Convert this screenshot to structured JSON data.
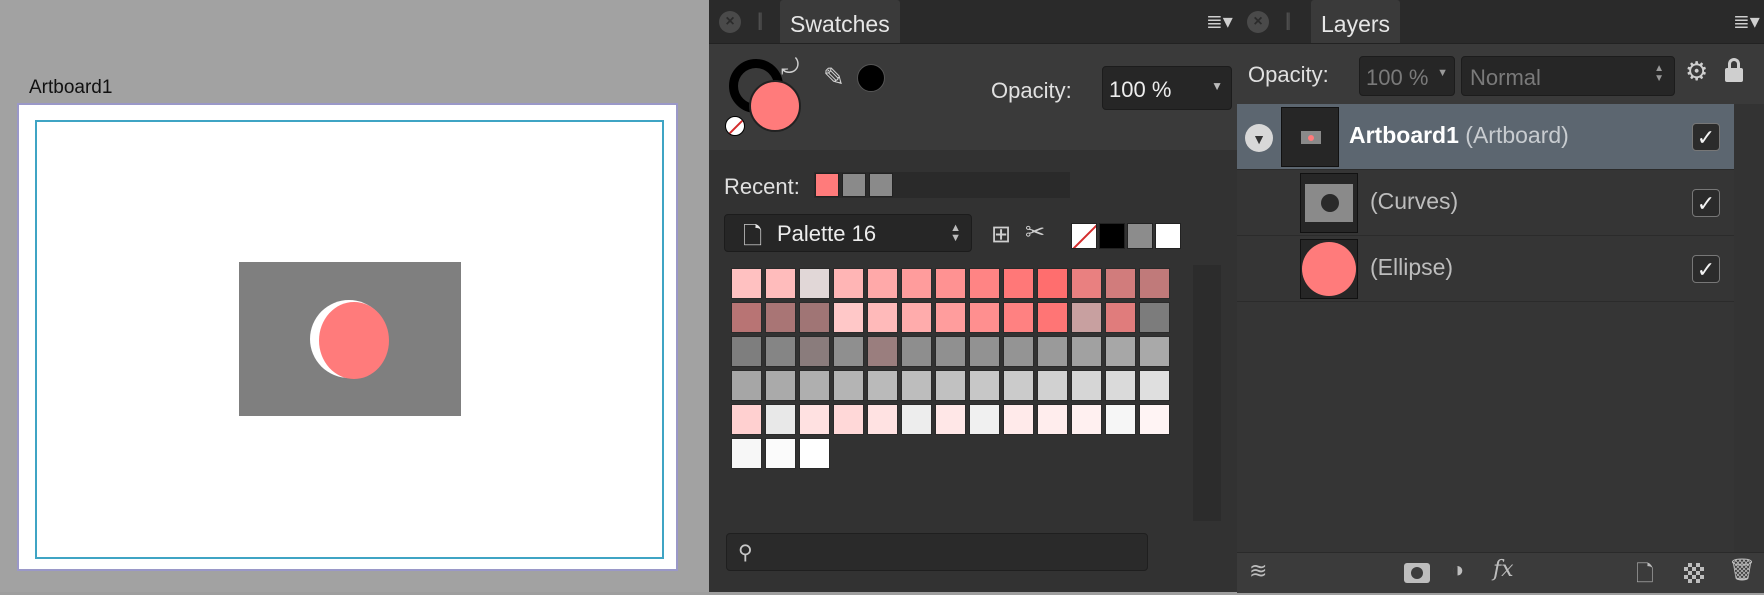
{
  "canvas": {
    "artboard_label": "Artboard1"
  },
  "swatches": {
    "tab_label": "Swatches",
    "opacity_label": "Opacity:",
    "opacity_value": "100 %",
    "recent_label": "Recent:",
    "recent_colors": [
      "#ff7b7b",
      "#8a8a8a",
      "#8a8a8a"
    ],
    "palette_name": "Palette 16",
    "quick_colors": [
      "none",
      "#000000",
      "#8c8c8c",
      "#ffffff"
    ],
    "grid": [
      [
        "#ffc1c1",
        "#ffbcbc",
        "#e1d7d7",
        "#ffb5b5",
        "#ffa9a9",
        "#ff9c9c",
        "#ff9292",
        "#ff8484",
        "#ff7878",
        "#ff6e6e",
        "#e98080",
        "#d17c7c",
        "#c07a7a"
      ],
      [
        "#b87474",
        "#a97575",
        "#a07575",
        "#ffc8c8",
        "#ffbaba",
        "#ffacac",
        "#ff9d9d",
        "#ff8f8f",
        "#ff8181",
        "#ff7575",
        "#c8a0a0",
        "#e07c7c",
        "#7c7c7c"
      ],
      [
        "#7e7e7e",
        "#858585",
        "#8a7c7c",
        "#8f8f8f",
        "#9a7e7e",
        "#8e8e8e",
        "#909090",
        "#929292",
        "#949494",
        "#9a9a9a",
        "#a1a1a1",
        "#a7a7a7",
        "#a9a9a9"
      ],
      [
        "#a6a6a6",
        "#aaaaaa",
        "#afafaf",
        "#b4b4b4",
        "#bababa",
        "#bdbdbd",
        "#c1c1c1",
        "#c7c7c7",
        "#cbcbcb",
        "#d1d1d1",
        "#d6d6d6",
        "#dadada",
        "#dfdfdf"
      ],
      [
        "#ffd0d0",
        "#e8e8e8",
        "#ffe1e1",
        "#ffd8d8",
        "#ffe2e2",
        "#ededed",
        "#ffe7e7",
        "#f0f0f0",
        "#ffeaea",
        "#ffeded",
        "#fff0f0",
        "#f6f6f6",
        "#fff4f4"
      ],
      [
        "#f7f7f7",
        "#fbfbfb",
        "#ffffff"
      ]
    ],
    "search_placeholder": ""
  },
  "layers": {
    "tab_label": "Layers",
    "opacity_label": "Opacity:",
    "opacity_value": "100 %",
    "blend_mode": "Normal",
    "rows": [
      {
        "name": "Artboard1",
        "type": "(Artboard)",
        "checked": "✓"
      },
      {
        "name": "",
        "type": "(Curves)",
        "checked": "✓"
      },
      {
        "name": "",
        "type": "(Ellipse)",
        "checked": "✓"
      }
    ]
  },
  "colors": {
    "accent_pink": "#ff7b7b",
    "selected_row": "#5c6670"
  }
}
